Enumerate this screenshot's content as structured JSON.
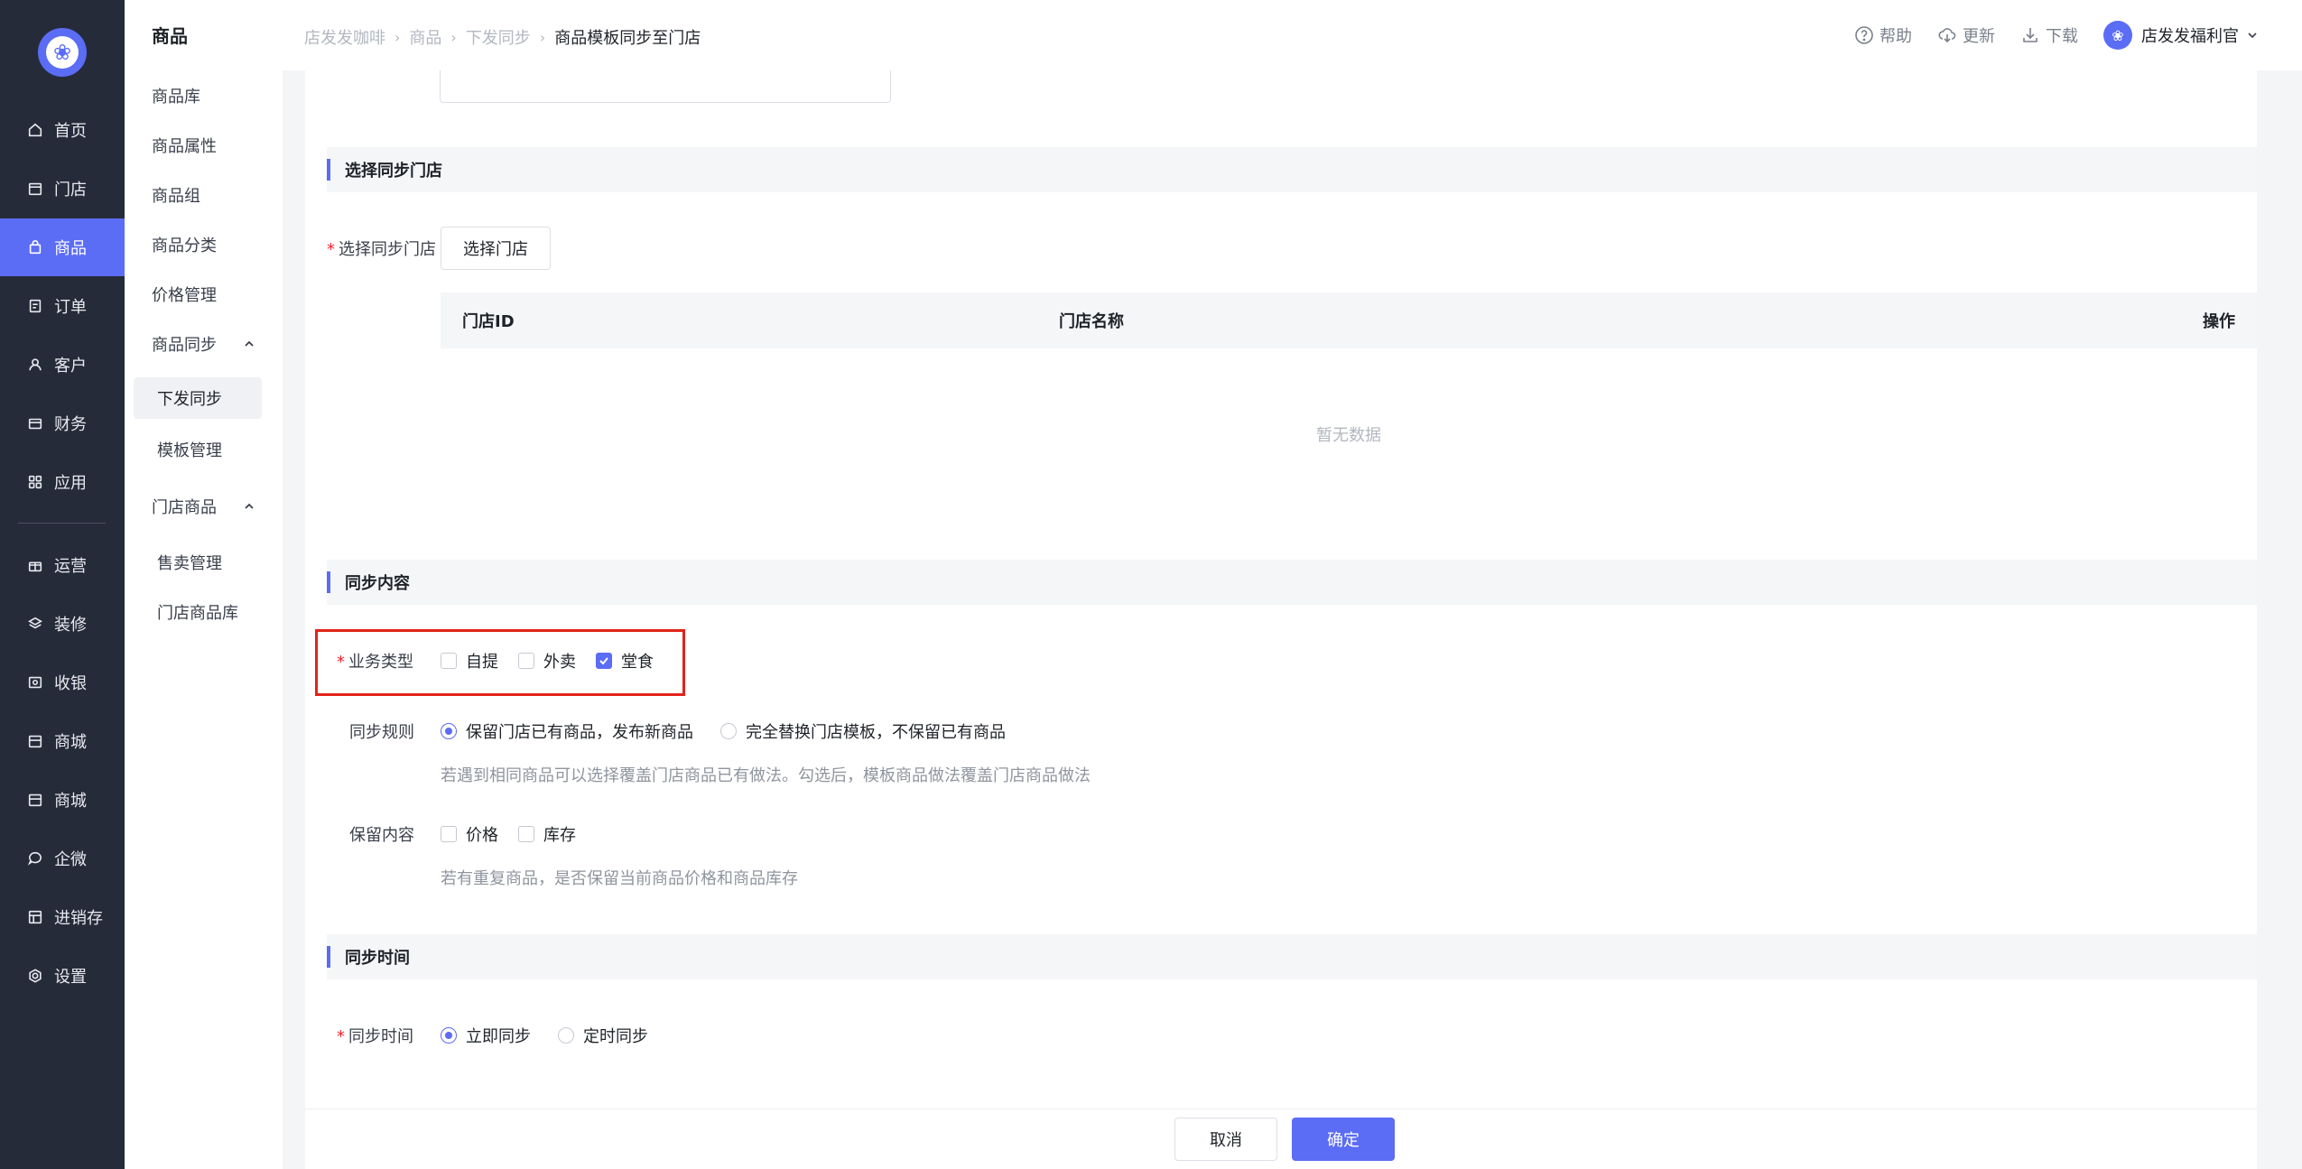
{
  "nav": {
    "items": [
      {
        "label": "首页",
        "icon": "home-icon"
      },
      {
        "label": "门店",
        "icon": "store-icon"
      },
      {
        "label": "商品",
        "icon": "bag-icon",
        "active": true
      },
      {
        "label": "订单",
        "icon": "order-icon"
      },
      {
        "label": "客户",
        "icon": "user-icon"
      },
      {
        "label": "财务",
        "icon": "wallet-icon"
      },
      {
        "label": "应用",
        "icon": "apps-icon"
      },
      {
        "label": "运营",
        "icon": "gift-icon"
      },
      {
        "label": "装修",
        "icon": "layers-icon"
      },
      {
        "label": "收银",
        "icon": "cashier-icon"
      },
      {
        "label": "商城",
        "icon": "shop-icon"
      },
      {
        "label": "商城",
        "icon": "shop-icon"
      },
      {
        "label": "企微",
        "icon": "chat-icon"
      },
      {
        "label": "进销存",
        "icon": "inventory-icon"
      },
      {
        "label": "设置",
        "icon": "gear-icon"
      }
    ]
  },
  "submenu": {
    "title": "商品",
    "items": [
      "商品库",
      "商品属性",
      "商品组",
      "商品分类",
      "价格管理"
    ],
    "group_sync": "商品同步",
    "sync_active": "下发同步",
    "sync_template": "模板管理",
    "group_store": "门店商品",
    "store_sale": "售卖管理",
    "store_lib": "门店商品库"
  },
  "header": {
    "breadcrumb": [
      "店发发咖啡",
      "商品",
      "下发同步",
      "商品模板同步至门店"
    ],
    "help": "帮助",
    "update": "更新",
    "download": "下载",
    "user_name": "店发发福利官"
  },
  "section_store": {
    "title": "选择同步门店",
    "label": "选择同步门店",
    "button": "选择门店",
    "columns": [
      "门店ID",
      "门店名称",
      "操作"
    ],
    "empty": "暂无数据"
  },
  "section_content": {
    "title": "同步内容",
    "business_label": "业务类型",
    "business_options": [
      {
        "label": "自提",
        "checked": false
      },
      {
        "label": "外卖",
        "checked": false
      },
      {
        "label": "堂食",
        "checked": true
      }
    ],
    "rule_label": "同步规则",
    "rule_options": [
      {
        "label": "保留门店已有商品，发布新商品",
        "checked": true
      },
      {
        "label": "完全替换门店模板，不保留已有商品",
        "checked": false
      }
    ],
    "rule_hint": "若遇到相同商品可以选择覆盖门店商品已有做法。勾选后，模板商品做法覆盖门店商品做法",
    "keep_label": "保留内容",
    "keep_options": [
      {
        "label": "价格",
        "checked": false
      },
      {
        "label": "库存",
        "checked": false
      }
    ],
    "keep_hint": "若有重复商品，是否保留当前商品价格和商品库存"
  },
  "section_time": {
    "title": "同步时间",
    "label": "同步时间",
    "options": [
      {
        "label": "立即同步",
        "checked": true
      },
      {
        "label": "定时同步",
        "checked": false
      }
    ]
  },
  "footer": {
    "cancel": "取消",
    "confirm": "确定"
  },
  "colors": {
    "accent": "#5b6cf5",
    "nav_bg": "#262b3a",
    "highlight": "#e2231a"
  }
}
